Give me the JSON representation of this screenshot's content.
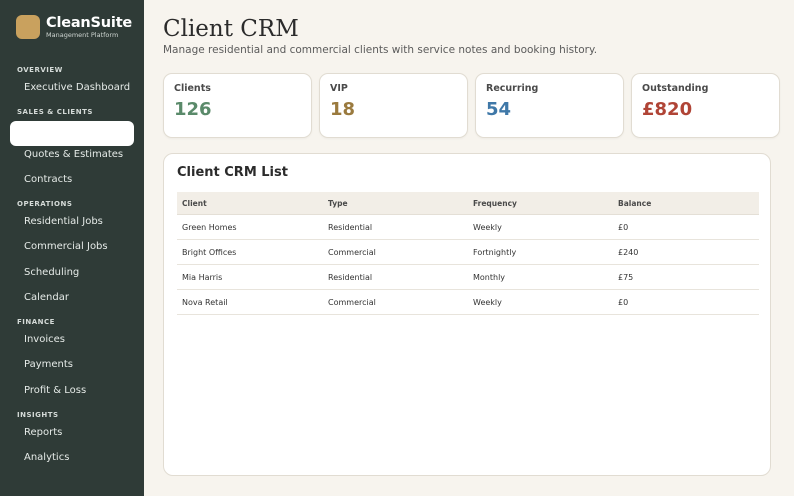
{
  "brand": {
    "name": "CleanSuite",
    "subtitle": "Management Platform",
    "logo_color": "#c9a15e"
  },
  "sidebar": {
    "sections": [
      {
        "title": "OVERVIEW",
        "items": [
          "Executive Dashboard"
        ]
      },
      {
        "title": "SALES & CLIENTS",
        "items": [
          "",
          "Quotes & Estimates",
          "Contracts"
        ]
      },
      {
        "title": "OPERATIONS",
        "items": [
          "Residential Jobs",
          "Commercial Jobs",
          "Scheduling",
          "Calendar"
        ]
      },
      {
        "title": "FINANCE",
        "items": [
          "Invoices",
          "Payments",
          "Profit & Loss"
        ]
      },
      {
        "title": "INSIGHTS",
        "items": [
          "Reports",
          "Analytics"
        ]
      }
    ]
  },
  "page": {
    "title": "Client CRM",
    "subtitle": "Manage residential and commercial clients with service notes and booking history."
  },
  "stats": [
    {
      "label": "Clients",
      "value": "126",
      "color": "#5a8a6a"
    },
    {
      "label": "VIP",
      "value": "18",
      "color": "#9a7a3e"
    },
    {
      "label": "Recurring",
      "value": "54",
      "color": "#3f78a8"
    },
    {
      "label": "Outstanding",
      "value": "£820",
      "color": "#b04436"
    }
  ],
  "crm": {
    "title": "Client CRM List",
    "columns": [
      "Client",
      "Type",
      "Frequency",
      "Balance"
    ],
    "rows": [
      [
        "Green Homes",
        "Residential",
        "Weekly",
        "£0"
      ],
      [
        "Bright Offices",
        "Commercial",
        "Fortnightly",
        "£240"
      ],
      [
        "Mia Harris",
        "Residential",
        "Monthly",
        "£75"
      ],
      [
        "Nova Retail",
        "Commercial",
        "Weekly",
        "£0"
      ]
    ]
  }
}
